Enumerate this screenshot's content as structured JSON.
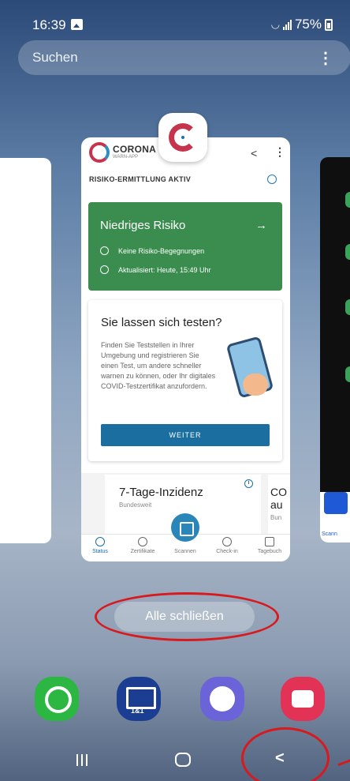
{
  "status_bar": {
    "time": "16:39",
    "battery": "75%"
  },
  "search": {
    "label": "Suchen"
  },
  "app_card": {
    "brand": "CORONA",
    "brand_sub": "WARN-APP",
    "risk_status": "RISIKO-ERMITTLUNG AKTIV",
    "risk_tile": {
      "title": "Niedriges Risiko",
      "arrow": "→",
      "encounters": "Keine Risiko-Begegnungen",
      "updated": "Aktualisiert: Heute, 15:49 Uhr"
    },
    "test_tile": {
      "title": "Sie lassen sich testen?",
      "body": "Finden Sie Teststellen in Ihrer Umgebung und registrieren Sie einen Test, um andere schneller warnen zu können, oder Ihr digitales COVID-Testzertifikat anzufordern.",
      "button": "WEITER"
    },
    "incidence": {
      "title": "7-Tage-Inzidenz",
      "subtitle": "Bundesweit",
      "info": "i",
      "next_title": "CO au",
      "next_sub": "Bun"
    },
    "bottom_nav": [
      "Status",
      "Zertifikate",
      "Scannen",
      "Check-in",
      "Tagebuch"
    ]
  },
  "right_card": {
    "label": "Scann"
  },
  "close_all": {
    "label": "Alle schließen"
  },
  "dock": {
    "mail_badge": "1&1"
  },
  "icons": [
    "gallery-icon",
    "wifi-icon",
    "signal-icon",
    "battery-icon",
    "more-icon",
    "share-icon",
    "virus-icon",
    "recent-apps-icon",
    "home-icon",
    "back-icon"
  ],
  "colors": {
    "accent_green": "#3a8d4e",
    "accent_blue": "#1a6fa0",
    "annotation_red": "#d8191e"
  }
}
